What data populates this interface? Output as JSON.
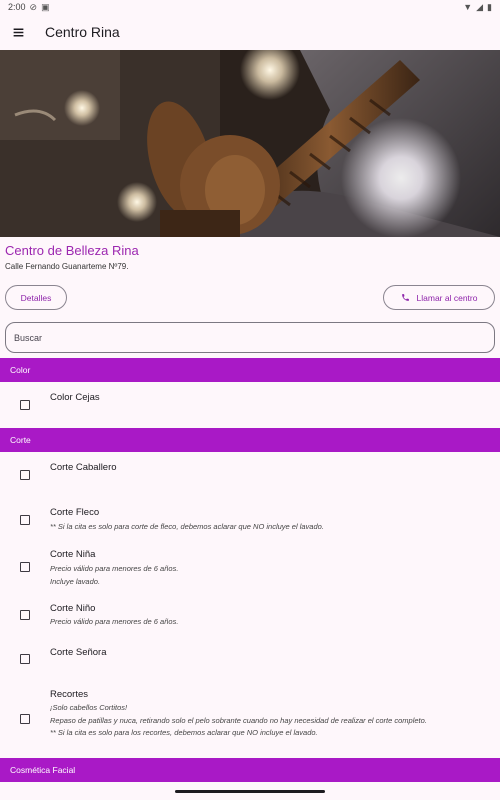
{
  "status_bar": {
    "time": "2:00"
  },
  "app_bar": {
    "title": "Centro Rina"
  },
  "center": {
    "name": "Centro de Belleza Rina",
    "address": "Calle Fernando Guanarteme Nº79."
  },
  "actions": {
    "details_label": "Detalles",
    "call_label": "Llamar al centro"
  },
  "search": {
    "placeholder": "Buscar",
    "value": ""
  },
  "sections": [
    {
      "title": "Color",
      "items": [
        {
          "name": "Color Cejas",
          "desc": ""
        }
      ]
    },
    {
      "title": "Corte",
      "items": [
        {
          "name": "Corte Caballero",
          "desc": ""
        },
        {
          "name": "Corte Fleco",
          "desc": "** Si la cita es solo para corte de fleco, debemos aclarar que NO incluye el lavado."
        },
        {
          "name": "Corte Niña",
          "desc": "Precio válido para menores de 6 años.\nIncluye lavado."
        },
        {
          "name": "Corte Niño",
          "desc": "Precio válido para menores de 6 años."
        },
        {
          "name": "Corte Señora",
          "desc": ""
        },
        {
          "name": "Recortes",
          "desc": "¡Solo cabellos Cortitos!\nRepaso de patillas y nuca, retirando solo el pelo sobrante cuando no hay necesidad de realizar el corte completo.\n** Si la cita es solo para los recortes, debemos aclarar que NO incluye el lavado."
        }
      ]
    },
    {
      "title": "Cosmética Facial",
      "items": []
    }
  ],
  "colors": {
    "accent": "#a919c6",
    "accent_text": "#8e24aa",
    "background": "#fef7fb"
  },
  "icons": {
    "menu": "menu-icon",
    "phone": "phone-icon"
  }
}
